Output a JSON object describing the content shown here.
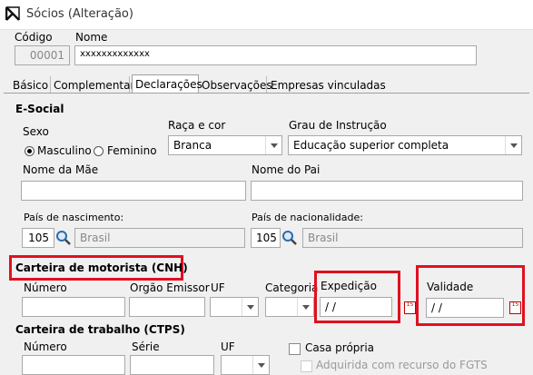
{
  "window": {
    "title": "Sócios (Alteração)"
  },
  "header": {
    "codigo_label": "Código",
    "codigo_value": "00001",
    "nome_label": "Nome",
    "nome_value": "xxxxxxxxxxxxx"
  },
  "tabs": [
    {
      "label": "Básico"
    },
    {
      "label": "Complementar"
    },
    {
      "label": "Declarações"
    },
    {
      "label": "Observações"
    },
    {
      "label": "Empresas vinculadas"
    }
  ],
  "esocial": {
    "section_title": "E-Social",
    "sexo_label": "Sexo",
    "sexo_options": [
      "Masculino",
      "Feminino"
    ],
    "raca_label": "Raça e cor",
    "raca_value": "Branca",
    "grau_label": "Grau de Instrução",
    "grau_value": "Educação superior completa",
    "nome_mae_label": "Nome da Mãe",
    "nome_mae_value": "",
    "nome_pai_label": "Nome do Pai",
    "nome_pai_value": "",
    "pais_nasc_label": "País de nascimento:",
    "pais_nasc_code": "105",
    "pais_nasc_name": "Brasil",
    "pais_nac_label": "País de nacionalidade:",
    "pais_nac_code": "105",
    "pais_nac_name": "Brasil"
  },
  "cnh": {
    "section_title": "Carteira de motorista (CNH)",
    "numero_label": "Número",
    "orgao_label": "Orgão Emissor",
    "uf_label": "UF",
    "categoria_label": "Categoria",
    "expedicao_label": "Expedição",
    "expedicao_value": "/ /",
    "validade_label": "Validade",
    "validade_value": "/ /",
    "calendar_glyph": "15"
  },
  "ctps": {
    "section_title": "Carteira de trabalho (CTPS)",
    "numero_label": "Número",
    "serie_label": "Série",
    "uf_label": "UF",
    "casa_propria_label": "Casa própria",
    "fgts_label": "Adquirida com recurso do FGTS"
  },
  "colors": {
    "highlight": "#e01020",
    "active_tab": "#ffffff"
  }
}
